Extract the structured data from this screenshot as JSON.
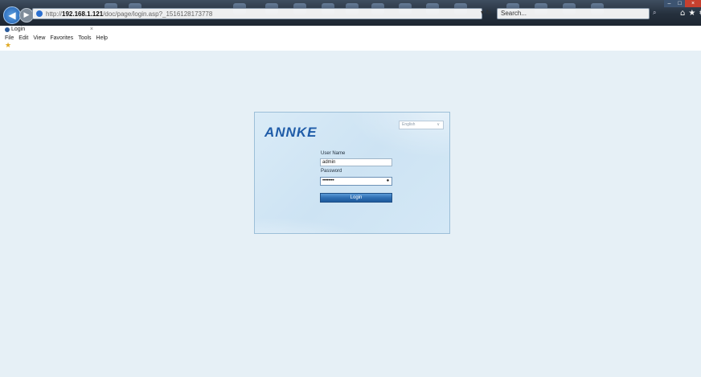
{
  "browser": {
    "address": {
      "prefix": "http://",
      "host": "192.168.1.121",
      "path": "/doc/page/login.asp?_1516128173778"
    },
    "refresh_glyph": "▾ ↻",
    "search_placeholder": "Search...",
    "tab_title": "Login",
    "tab_close": "×",
    "menu": [
      "File",
      "Edit",
      "View",
      "Favorites",
      "Tools",
      "Help"
    ]
  },
  "login": {
    "brand": "ANNKE",
    "language": "English",
    "username_label": "User Name",
    "username_value": "admin",
    "password_label": "Password",
    "password_value": "••••••••",
    "submit_label": "Login"
  },
  "colors": {
    "page_bg": "#e6f0f6",
    "brand": "#1f5ca8",
    "button": "#2f6fb3"
  },
  "icons": [
    "back-arrow-icon",
    "forward-arrow-icon",
    "globe-icon",
    "search-icon",
    "home-icon",
    "star-icon",
    "gear-icon",
    "close-icon",
    "favorites-star-icon",
    "chevron-down-icon",
    "reveal-password-icon"
  ]
}
